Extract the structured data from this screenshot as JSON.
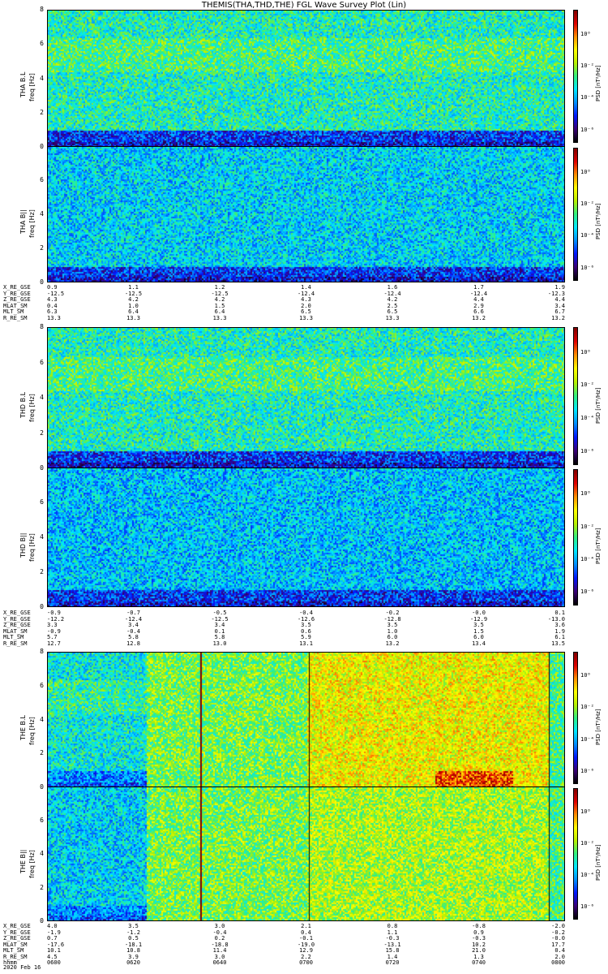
{
  "title": "THEMIS(THA,THD,THE) FGL Wave Survey Plot (Lin)",
  "date_label": "2020 Feb 16",
  "colors": {
    "colormap": [
      "#000000",
      "#3a0078",
      "#0018ff",
      "#0090ff",
      "#00e8ff",
      "#30f080",
      "#b8f000",
      "#ffff00",
      "#ff9000",
      "#e00000",
      "#800000"
    ]
  },
  "chart_data": [
    {
      "type": "heatmap",
      "probe": "THA",
      "ylabel": "THA B.L",
      "yunits": "freq [Hz]",
      "yticks": [
        "0",
        "2",
        "4",
        "6",
        "8"
      ],
      "ylim": [
        0,
        8
      ],
      "colorbar_title": "PSD [nT²/Hz]",
      "colorbar_ticks": [
        "10⁰",
        "10⁻²",
        "10⁻⁴",
        "10⁻⁶"
      ],
      "base_level": 0.45,
      "low_band_level": 0.22
    },
    {
      "type": "heatmap",
      "probe": "THA",
      "ylabel": "THA B||",
      "yunits": "freq [Hz]",
      "yticks": [
        "0",
        "2",
        "4",
        "6"
      ],
      "ylim": [
        0,
        8
      ],
      "colorbar_title": "PSD [nT²/Hz]",
      "colorbar_ticks": [
        "10⁰",
        "10⁻²",
        "10⁻⁴",
        "10⁻⁶"
      ],
      "base_level": 0.38,
      "low_band_level": 0.22
    },
    {
      "type": "heatmap",
      "probe": "THD",
      "ylabel": "THD B.L",
      "yunits": "freq [Hz]",
      "yticks": [
        "0",
        "2",
        "4",
        "6",
        "8"
      ],
      "ylim": [
        0,
        8
      ],
      "colorbar_title": "PSD [nT²/Hz]",
      "colorbar_ticks": [
        "10⁰",
        "10⁻²",
        "10⁻⁴",
        "10⁻⁶"
      ],
      "base_level": 0.45,
      "low_band_level": 0.22
    },
    {
      "type": "heatmap",
      "probe": "THD",
      "ylabel": "THD B||",
      "yunits": "freq [Hz]",
      "yticks": [
        "0",
        "2",
        "4",
        "6"
      ],
      "ylim": [
        0,
        8
      ],
      "colorbar_title": "PSD [nT²/Hz]",
      "colorbar_ticks": [
        "10⁰",
        "10⁻²",
        "10⁻⁴",
        "10⁻⁶"
      ],
      "base_level": 0.36,
      "low_band_level": 0.22
    },
    {
      "type": "heatmap",
      "probe": "THE",
      "ylabel": "THE B.L",
      "yunits": "freq [Hz]",
      "yticks": [
        "0",
        "2",
        "4",
        "6",
        "8"
      ],
      "ylim": [
        0,
        8
      ],
      "colorbar_title": "PSD [nT²/Hz]",
      "colorbar_ticks": [
        "10⁰",
        "10⁻²",
        "10⁻⁴",
        "10⁻⁶"
      ],
      "base_level": 0.42,
      "low_band_level": 0.3
    },
    {
      "type": "heatmap",
      "probe": "THE",
      "ylabel": "THE B||",
      "yunits": "freq [Hz]",
      "yticks": [
        "0",
        "2",
        "4",
        "6"
      ],
      "ylim": [
        0,
        8
      ],
      "colorbar_title": "PSD [nT²/Hz]",
      "colorbar_ticks": [
        "10⁰",
        "10⁻²",
        "10⁻⁴",
        "10⁻⁶"
      ],
      "base_level": 0.38,
      "low_band_level": 0.3
    }
  ],
  "ephemeris": [
    {
      "rows": [
        {
          "label": "X_RE_GSE",
          "values": [
            "0.9",
            "1.1",
            "1.2",
            "1.4",
            "1.6",
            "1.7",
            "1.9"
          ]
        },
        {
          "label": "Y_RE_GSE",
          "values": [
            "-12.5",
            "-12.5",
            "-12.5",
            "-12.4",
            "-12.4",
            "-12.4",
            "-12.3"
          ]
        },
        {
          "label": "Z_RE_GSE",
          "values": [
            "4.3",
            "4.2",
            "4.2",
            "4.3",
            "4.2",
            "4.4",
            "4.4"
          ]
        },
        {
          "label": "MLAT_SM",
          "values": [
            "0.4",
            "1.0",
            "1.5",
            "2.0",
            "2.5",
            "2.9",
            "3.4"
          ]
        },
        {
          "label": "MLT_SM",
          "values": [
            "6.3",
            "6.4",
            "6.4",
            "6.5",
            "6.5",
            "6.6",
            "6.7"
          ]
        },
        {
          "label": "R_RE_SM",
          "values": [
            "13.3",
            "13.3",
            "13.3",
            "13.3",
            "13.3",
            "13.2",
            "13.2"
          ]
        }
      ]
    },
    {
      "rows": [
        {
          "label": "X_RE_GSE",
          "values": [
            "-0.9",
            "-0.7",
            "-0.5",
            "-0.4",
            "-0.2",
            "-0.0",
            "0.1"
          ]
        },
        {
          "label": "Y_RE_GSE",
          "values": [
            "-12.2",
            "-12.4",
            "-12.5",
            "-12.6",
            "-12.8",
            "-12.9",
            "-13.0"
          ]
        },
        {
          "label": "Z_RE_GSE",
          "values": [
            "3.3",
            "3.4",
            "3.4",
            "3.5",
            "3.5",
            "3.5",
            "3.6"
          ]
        },
        {
          "label": "MLAT_SM",
          "values": [
            "-0.9",
            "-0.4",
            "0.1",
            "0.6",
            "1.0",
            "1.5",
            "1.9"
          ]
        },
        {
          "label": "MLT_SM",
          "values": [
            "5.7",
            "5.8",
            "5.8",
            "5.9",
            "6.0",
            "6.0",
            "6.1"
          ]
        },
        {
          "label": "R_RE_SM",
          "values": [
            "12.7",
            "12.8",
            "13.0",
            "13.1",
            "13.2",
            "13.4",
            "13.5"
          ]
        }
      ]
    },
    {
      "rows": [
        {
          "label": "X_RE_GSE",
          "values": [
            "4.0",
            "3.5",
            "3.0",
            "2.1",
            "0.8",
            "-0.8",
            "-2.0"
          ]
        },
        {
          "label": "Y_RE_GSE",
          "values": [
            "-1.9",
            "-1.2",
            "-0.4",
            "0.4",
            "1.1",
            "0.9",
            "-0.2"
          ]
        },
        {
          "label": "Z_RE_GSE",
          "values": [
            "0.7",
            "0.5",
            "0.2",
            "-0.1",
            "-0.3",
            "-0.3",
            "-0.0"
          ]
        },
        {
          "label": "MLAT_SM",
          "values": [
            "-17.6",
            "-18.1",
            "-18.8",
            "-19.0",
            "-13.1",
            "10.2",
            "17.7"
          ]
        },
        {
          "label": "MLT_SM",
          "values": [
            "10.1",
            "10.8",
            "11.4",
            "12.9",
            "15.8",
            "21.0",
            "0.4"
          ]
        },
        {
          "label": "R_RE_SM",
          "values": [
            "4.5",
            "3.9",
            "3.0",
            "2.2",
            "1.4",
            "1.3",
            "2.0"
          ]
        },
        {
          "label": "hhmm",
          "values": [
            "0600",
            "0620",
            "0640",
            "0700",
            "0720",
            "0740",
            "0800"
          ]
        }
      ]
    }
  ]
}
